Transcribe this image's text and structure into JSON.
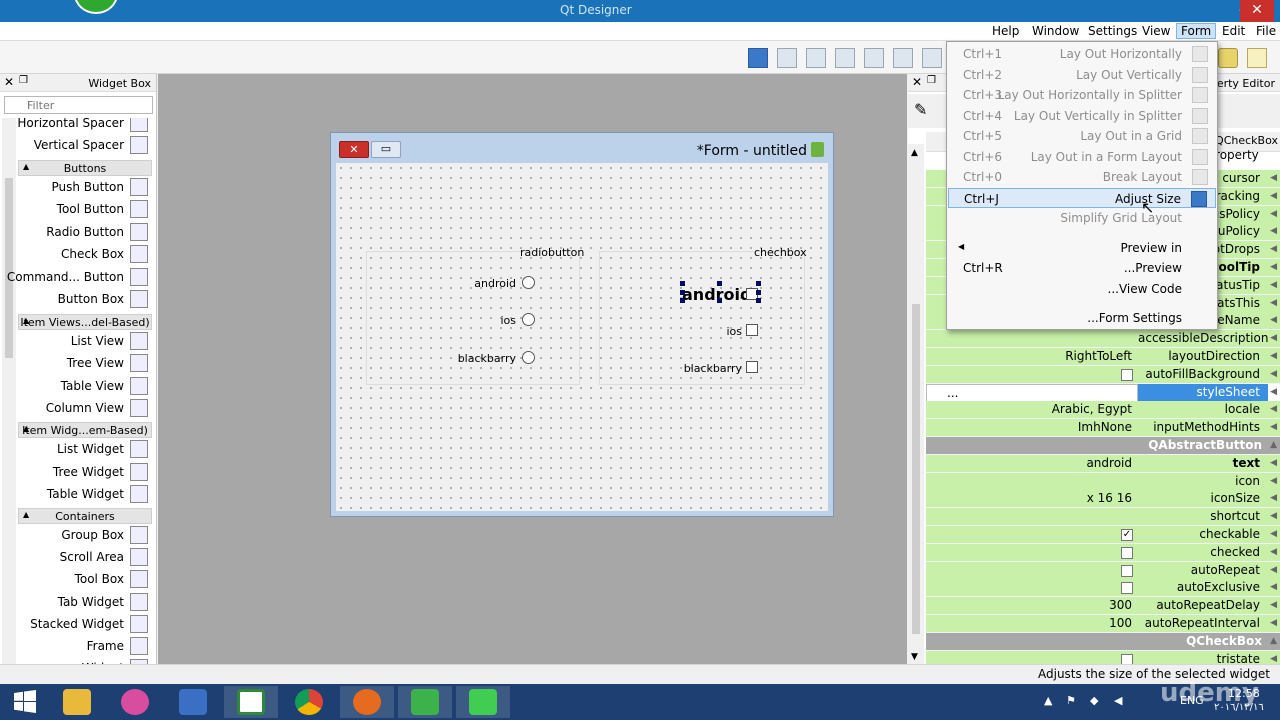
{
  "window": {
    "title": "Qt Designer",
    "close_glyph": "✕",
    "min_glyph": "—"
  },
  "menubar": {
    "items": [
      "Help",
      "Window",
      "Settings",
      "View",
      "Form",
      "Edit",
      "File"
    ],
    "active": "Form"
  },
  "widget_box": {
    "title": "Widget Box",
    "filter_placeholder": "Filter",
    "rows": [
      {
        "kind": "item",
        "label": "Horizontal Spacer",
        "icon": "spacer-icon"
      },
      {
        "kind": "item",
        "label": "Vertical Spacer",
        "icon": "vertical-spacer-icon"
      },
      {
        "kind": "category",
        "label": "Buttons"
      },
      {
        "kind": "item",
        "label": "Push Button",
        "icon": "push-button-icon"
      },
      {
        "kind": "item",
        "label": "Tool Button",
        "icon": "tool-button-icon"
      },
      {
        "kind": "item",
        "label": "Radio Button",
        "icon": "radio-button-icon"
      },
      {
        "kind": "item",
        "label": "Check Box",
        "icon": "check-box-icon"
      },
      {
        "kind": "item",
        "label": "Command... Button",
        "icon": "command-link-icon"
      },
      {
        "kind": "item",
        "label": "Button Box",
        "icon": "button-box-icon"
      },
      {
        "kind": "category",
        "label": "Item Views...del-Based)"
      },
      {
        "kind": "item",
        "label": "List View",
        "icon": "list-view-icon"
      },
      {
        "kind": "item",
        "label": "Tree View",
        "icon": "tree-view-icon"
      },
      {
        "kind": "item",
        "label": "Table View",
        "icon": "table-view-icon"
      },
      {
        "kind": "item",
        "label": "Column View",
        "icon": "column-view-icon"
      },
      {
        "kind": "category",
        "label": "Item Widg...em-Based)"
      },
      {
        "kind": "item",
        "label": "List Widget",
        "icon": "list-widget-icon"
      },
      {
        "kind": "item",
        "label": "Tree Widget",
        "icon": "tree-widget-icon"
      },
      {
        "kind": "item",
        "label": "Table Widget",
        "icon": "table-widget-icon"
      },
      {
        "kind": "category",
        "label": "Containers"
      },
      {
        "kind": "item",
        "label": "Group Box",
        "icon": "group-box-icon"
      },
      {
        "kind": "item",
        "label": "Scroll Area",
        "icon": "scroll-area-icon"
      },
      {
        "kind": "item",
        "label": "Tool Box",
        "icon": "tool-box-icon"
      },
      {
        "kind": "item",
        "label": "Tab Widget",
        "icon": "tab-widget-icon"
      },
      {
        "kind": "item",
        "label": "Stacked Widget",
        "icon": "stacked-widget-icon"
      },
      {
        "kind": "item",
        "label": "Frame",
        "icon": "frame-icon"
      },
      {
        "kind": "item",
        "label": "Widget",
        "icon": "widget-icon"
      }
    ]
  },
  "form": {
    "title": "*Form - untitled",
    "radio_group": {
      "title": "radiobutton",
      "options": [
        "android",
        "ios",
        "blackbarry"
      ]
    },
    "check_group": {
      "title": "chechbox",
      "options": [
        "android",
        "ios",
        "blackbarry"
      ]
    }
  },
  "form_menu": {
    "items": [
      {
        "shortcut": "Ctrl+1",
        "label": "Lay Out Horizontally",
        "enabled": false,
        "icon": "layout-horizontal-icon"
      },
      {
        "shortcut": "Ctrl+2",
        "label": "Lay Out Vertically",
        "enabled": false,
        "icon": "layout-vertical-icon"
      },
      {
        "shortcut": "Ctrl+3",
        "label": "Lay Out Horizontally in Splitter",
        "enabled": false,
        "icon": "splitter-horizontal-icon"
      },
      {
        "shortcut": "Ctrl+4",
        "label": "Lay Out Vertically in Splitter",
        "enabled": false,
        "icon": "splitter-vertical-icon"
      },
      {
        "shortcut": "Ctrl+5",
        "label": "Lay Out in a Grid",
        "enabled": false,
        "icon": "grid-layout-icon"
      },
      {
        "shortcut": "Ctrl+6",
        "label": "Lay Out in a Form Layout",
        "enabled": false,
        "icon": "form-layout-icon"
      },
      {
        "shortcut": "Ctrl+0",
        "label": "Break Layout",
        "enabled": false,
        "icon": "break-layout-icon"
      },
      {
        "shortcut": "Ctrl+J",
        "label": "Adjust Size",
        "enabled": true,
        "highlight": true,
        "icon": "adjust-size-icon"
      },
      {
        "shortcut": "",
        "label": "Simplify Grid Layout",
        "enabled": false,
        "icon": ""
      },
      {
        "shortcut": "",
        "label": "Preview in",
        "enabled": true,
        "submenu": true,
        "icon": ""
      },
      {
        "shortcut": "Ctrl+R",
        "label": "...Preview",
        "enabled": true,
        "icon": ""
      },
      {
        "shortcut": "",
        "label": "...View Code",
        "enabled": true,
        "icon": ""
      },
      {
        "shortcut": "",
        "label": "...Form Settings",
        "enabled": true,
        "icon": ""
      }
    ]
  },
  "property_editor": {
    "title": "Property Editor",
    "object_class": ": QCheckBox",
    "header": "Property",
    "rows": [
      {
        "name": "cursor",
        "value": "",
        "style": "green"
      },
      {
        "name": "mouseTracking",
        "value": "",
        "style": "green"
      },
      {
        "name": "focusPolicy",
        "value": "",
        "style": "green"
      },
      {
        "name": "contextMenuPolicy",
        "value": "",
        "style": "green"
      },
      {
        "name": "acceptDrops",
        "value": "",
        "style": "green"
      },
      {
        "name": "toolTip",
        "value": "",
        "style": "green bold"
      },
      {
        "name": "statusTip",
        "value": "",
        "style": "green"
      },
      {
        "name": "whatsThis",
        "value": "",
        "style": "green"
      },
      {
        "name": "accessibleName",
        "value": "",
        "style": "green"
      },
      {
        "name": "accessibleDescription",
        "value": "",
        "style": "green"
      },
      {
        "name": "layoutDirection",
        "value": "RightToLeft",
        "style": "green"
      },
      {
        "name": "autoFillBackground",
        "value": "",
        "check": false,
        "style": "green"
      },
      {
        "name": "styleSheet",
        "value": "...",
        "style": "edit"
      },
      {
        "name": "locale",
        "value": "Arabic, Egypt",
        "style": "green"
      },
      {
        "name": "inputMethodHints",
        "value": "ImhNone",
        "style": "green"
      },
      {
        "name": "QAbstractButton",
        "value": "",
        "style": "head"
      },
      {
        "name": "text",
        "value": "android",
        "style": "green bold"
      },
      {
        "name": "icon",
        "value": "",
        "style": "green"
      },
      {
        "name": "iconSize",
        "value": "x 16 16",
        "style": "green"
      },
      {
        "name": "shortcut",
        "value": "",
        "style": "green"
      },
      {
        "name": "checkable",
        "value": "",
        "check": true,
        "style": "green"
      },
      {
        "name": "checked",
        "value": "",
        "check": false,
        "style": "green"
      },
      {
        "name": "autoRepeat",
        "value": "",
        "check": false,
        "style": "green"
      },
      {
        "name": "autoExclusive",
        "value": "",
        "check": false,
        "style": "green"
      },
      {
        "name": "autoRepeatDelay",
        "value": "300",
        "style": "green"
      },
      {
        "name": "autoRepeatInterval",
        "value": "100",
        "style": "green"
      },
      {
        "name": "QCheckBox",
        "value": "",
        "style": "head"
      },
      {
        "name": "tristate",
        "value": "",
        "check": false,
        "style": "green"
      }
    ]
  },
  "statusbar": {
    "text": "Adjusts the size of the selected widget"
  },
  "taskbar": {
    "apps": [
      "windows-start-icon",
      "file-explorer-icon",
      "browser-icon",
      "powershell-icon",
      "camtasia-icon",
      "chrome-icon",
      "firefox-icon",
      "idm-icon",
      "qt-creator-icon"
    ],
    "language": "ENG",
    "time": "12:58",
    "date": "٢٠١٦/١٢/١٦"
  },
  "watermark": "udemy"
}
